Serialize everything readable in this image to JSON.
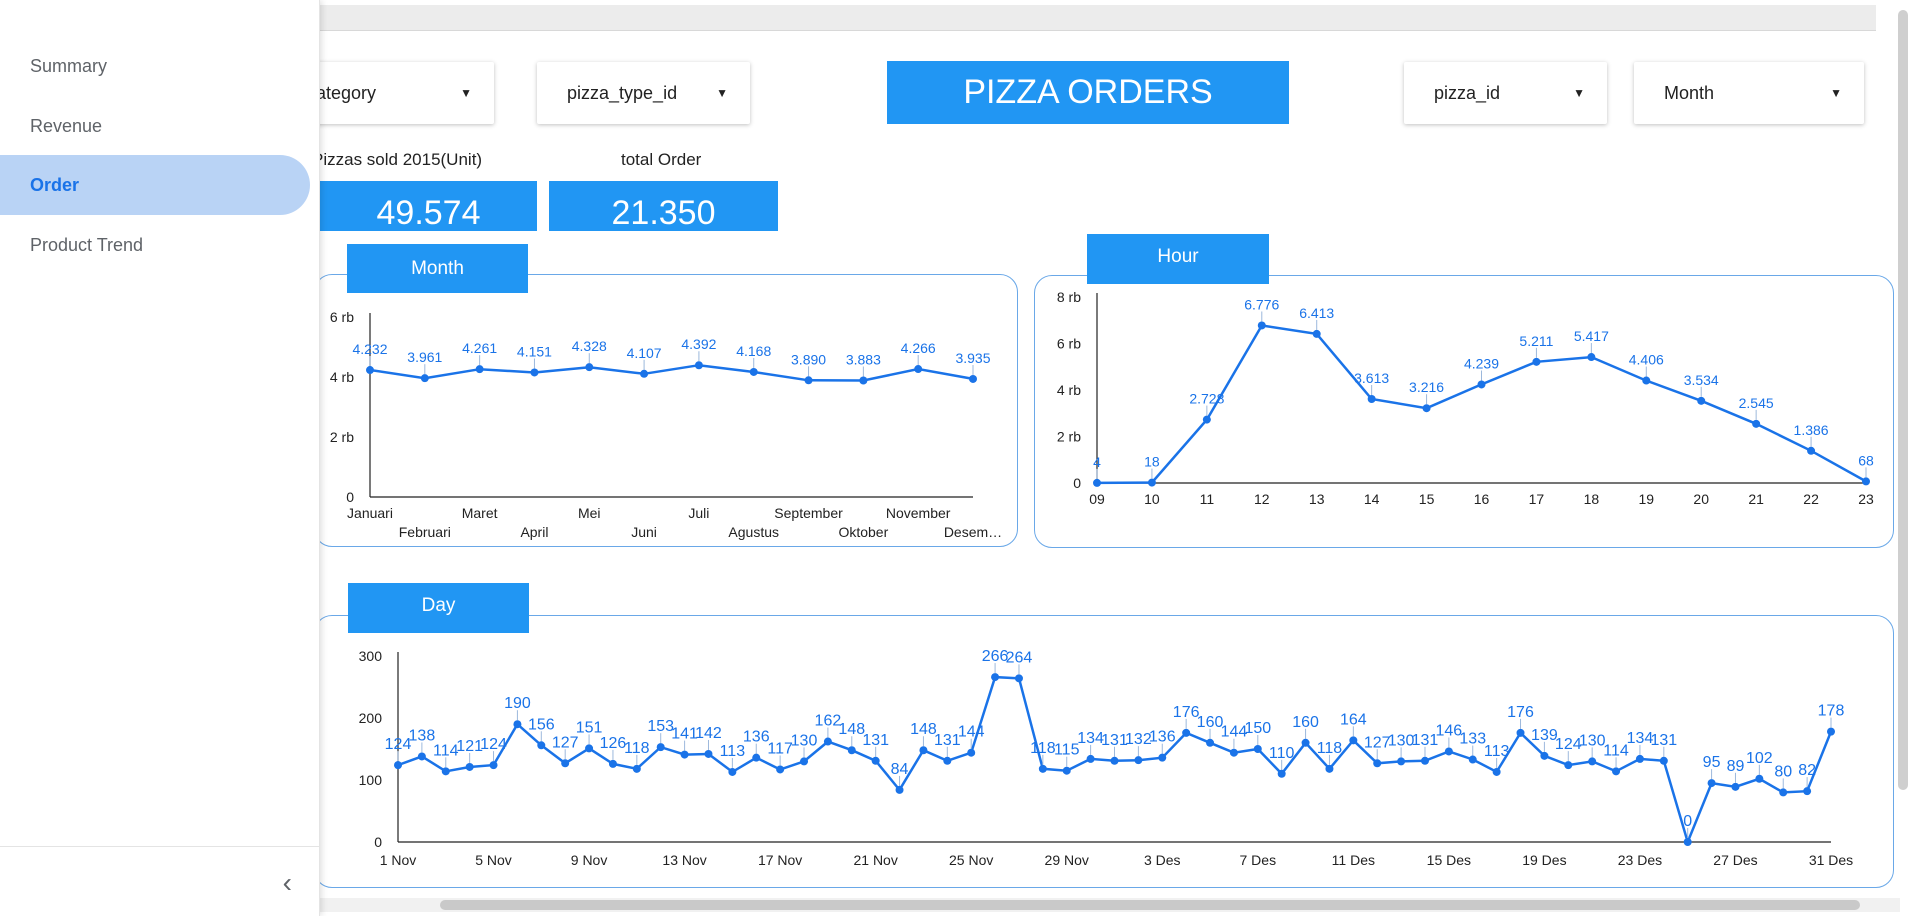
{
  "sidebar": {
    "items": [
      {
        "label": "Summary",
        "active": false
      },
      {
        "label": "Revenue",
        "active": false
      },
      {
        "label": "Order",
        "active": true
      },
      {
        "label": "Product Trend",
        "active": false
      }
    ],
    "collapse_icon": "chevron-left-icon"
  },
  "filters": {
    "category": "ategory",
    "pizza_type_id": "pizza_type_id",
    "pizza_id": "pizza_id",
    "month": "Month"
  },
  "title": "PIZZA ORDERS",
  "kpis": {
    "pizzas_sold_label": "Pizzas sold 2015(Unit)",
    "pizzas_sold_value": "49.574",
    "total_order_label": "total Order",
    "total_order_value": "21.350"
  },
  "colors": {
    "accent": "#2196f3",
    "line": "#1a73e8",
    "nav_active_bg": "#b9d3f5"
  },
  "chart_data": [
    {
      "type": "line",
      "title": "Month",
      "categories": [
        "Januari",
        "Februari",
        "Maret",
        "April",
        "Mei",
        "Juni",
        "Juli",
        "Agustus",
        "September",
        "Oktober",
        "November",
        "Desem…"
      ],
      "values": [
        4232,
        3961,
        4261,
        4151,
        4328,
        4107,
        4392,
        4168,
        3890,
        3883,
        4266,
        3935
      ],
      "data_labels": [
        "4.232",
        "3.961",
        "4.261",
        "4.151",
        "4.328",
        "4.107",
        "4.392",
        "4.168",
        "3.890",
        "3.883",
        "4.266",
        "3.935"
      ],
      "y_ticks": [
        "0",
        "2 rb",
        "4 rb",
        "6 rb"
      ],
      "ylim": [
        0,
        6000
      ]
    },
    {
      "type": "line",
      "title": "Hour",
      "categories": [
        "09",
        "10",
        "11",
        "12",
        "13",
        "14",
        "15",
        "16",
        "17",
        "18",
        "19",
        "20",
        "21",
        "22",
        "23"
      ],
      "values": [
        4,
        18,
        2728,
        6776,
        6413,
        3613,
        3216,
        4239,
        5211,
        5417,
        4406,
        3534,
        2545,
        1386,
        68
      ],
      "data_labels": [
        "4",
        "18",
        "2.728",
        "6.776",
        "6.413",
        "3.613",
        "3.216",
        "4.239",
        "5.211",
        "5.417",
        "4.406",
        "3.534",
        "2.545",
        "1.386",
        "68"
      ],
      "y_ticks": [
        "0",
        "2 rb",
        "4 rb",
        "6 rb",
        "8 rb"
      ],
      "ylim": [
        0,
        8000
      ]
    },
    {
      "type": "line",
      "title": "Day",
      "x_tick_labels": [
        "1 Nov",
        "5 Nov",
        "9 Nov",
        "13 Nov",
        "17 Nov",
        "21 Nov",
        "25 Nov",
        "29 Nov",
        "3 Des",
        "7 Des",
        "11 Des",
        "15 Des",
        "19 Des",
        "23 Des",
        "27 Des",
        "31 Des"
      ],
      "values": [
        124,
        138,
        114,
        121,
        124,
        190,
        156,
        127,
        151,
        126,
        118,
        153,
        141,
        142,
        113,
        136,
        117,
        130,
        162,
        148,
        131,
        84,
        148,
        131,
        144,
        266,
        264,
        118,
        115,
        134,
        131,
        132,
        136,
        176,
        160,
        144,
        150,
        110,
        160,
        118,
        164,
        127,
        130,
        131,
        146,
        133,
        113,
        176,
        139,
        124,
        130,
        114,
        134,
        131,
        0,
        95,
        89,
        102,
        80,
        82,
        178
      ],
      "y_ticks": [
        "0",
        "100",
        "200",
        "300"
      ],
      "ylim": [
        0,
        300
      ]
    }
  ]
}
